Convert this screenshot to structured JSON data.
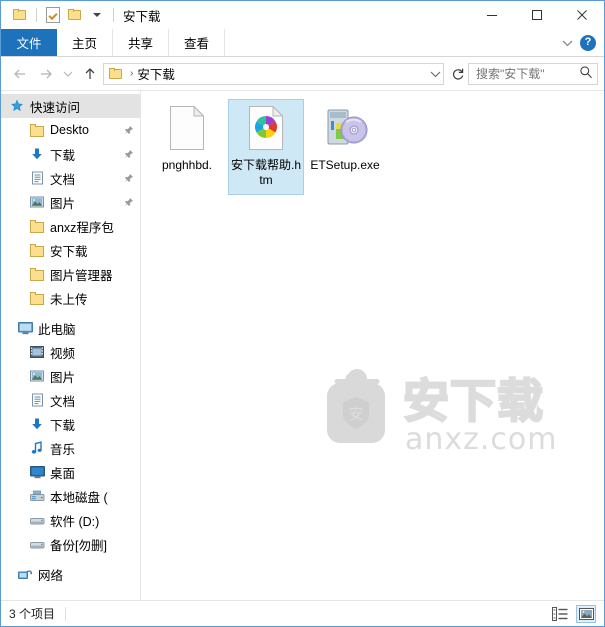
{
  "window": {
    "title": "安下载",
    "quick_access_toolbar": [
      {
        "name": "folder-properties",
        "icon": "folder-icon"
      },
      {
        "name": "properties",
        "icon": "doc-check-icon"
      },
      {
        "name": "new-folder",
        "icon": "folder-icon"
      },
      {
        "name": "customize-dropdown",
        "icon": "chevron-down-icon"
      }
    ],
    "controls": {
      "minimize": "—",
      "maximize": "□",
      "close": "✕"
    }
  },
  "ribbon": {
    "tabs": [
      {
        "label": "文件",
        "active": true
      },
      {
        "label": "主页",
        "active": false
      },
      {
        "label": "共享",
        "active": false
      },
      {
        "label": "查看",
        "active": false
      }
    ],
    "expand_icon": "chevron-down-icon",
    "help_label": "?"
  },
  "address": {
    "back_icon": "arrow-left-icon",
    "forward_icon": "arrow-right-icon",
    "recent_icon": "chevron-down-icon",
    "up_icon": "arrow-up-icon",
    "crumb_folder_icon": "folder-icon",
    "crumb_separator": "›",
    "crumb": "安下载",
    "dropdown_icon": "chevron-down-icon",
    "refresh_icon": "refresh-icon"
  },
  "search": {
    "placeholder": "搜索\"安下载\"",
    "value": "",
    "icon": "search-icon"
  },
  "sidebar": {
    "groups": [
      {
        "header": {
          "label": "快速访问",
          "icon": "star-pin-icon",
          "selected": true
        },
        "items": [
          {
            "label": "Deskto",
            "icon": "folder-icon",
            "pinned": true
          },
          {
            "label": "下载",
            "icon": "download-arrow-icon",
            "pinned": true
          },
          {
            "label": "文档",
            "icon": "documents-icon",
            "pinned": true
          },
          {
            "label": "图片",
            "icon": "pictures-icon",
            "pinned": true
          },
          {
            "label": "anxz程序包",
            "icon": "folder-icon",
            "pinned": false
          },
          {
            "label": "安下载",
            "icon": "folder-icon",
            "pinned": false
          },
          {
            "label": "图片管理器",
            "icon": "folder-icon",
            "pinned": false
          },
          {
            "label": "未上传",
            "icon": "folder-icon",
            "pinned": false
          }
        ]
      },
      {
        "header": {
          "label": "此电脑",
          "icon": "this-pc-icon",
          "selected": false
        },
        "items": [
          {
            "label": "视频",
            "icon": "videos-icon",
            "pinned": false
          },
          {
            "label": "图片",
            "icon": "pictures-icon",
            "pinned": false
          },
          {
            "label": "文档",
            "icon": "documents-icon",
            "pinned": false
          },
          {
            "label": "下载",
            "icon": "download-arrow-icon",
            "pinned": false
          },
          {
            "label": "音乐",
            "icon": "music-note-icon",
            "pinned": false
          },
          {
            "label": "桌面",
            "icon": "desktop-icon",
            "pinned": false
          },
          {
            "label": "本地磁盘 (",
            "icon": "local-disk-icon",
            "pinned": false
          },
          {
            "label": "软件 (D:)",
            "icon": "drive-icon",
            "pinned": false
          },
          {
            "label": "备份[勿删]",
            "icon": "drive-icon",
            "pinned": false
          }
        ]
      },
      {
        "header": {
          "label": "网络",
          "icon": "network-icon",
          "selected": false
        },
        "items": []
      }
    ]
  },
  "files": [
    {
      "name": "pnghhbd.",
      "icon": "blank-document-icon",
      "selected": false
    },
    {
      "name": "安下载帮助.htm",
      "icon": "chrome-html-icon",
      "selected": true
    },
    {
      "name": "ETSetup.exe",
      "icon": "setup-installer-icon",
      "selected": false
    }
  ],
  "watermark": {
    "logo_char": "安",
    "brand": "安下载",
    "site": "anxz.com"
  },
  "statusbar": {
    "item_count": "3 个项目",
    "views": [
      {
        "name": "details-view",
        "active": false
      },
      {
        "name": "large-icons-view",
        "active": true
      }
    ]
  },
  "colors": {
    "accent": "#1e72bb",
    "selection": "#cfe8f6",
    "window_border": "#5b9bd5",
    "folder": "#fcdf8d"
  }
}
